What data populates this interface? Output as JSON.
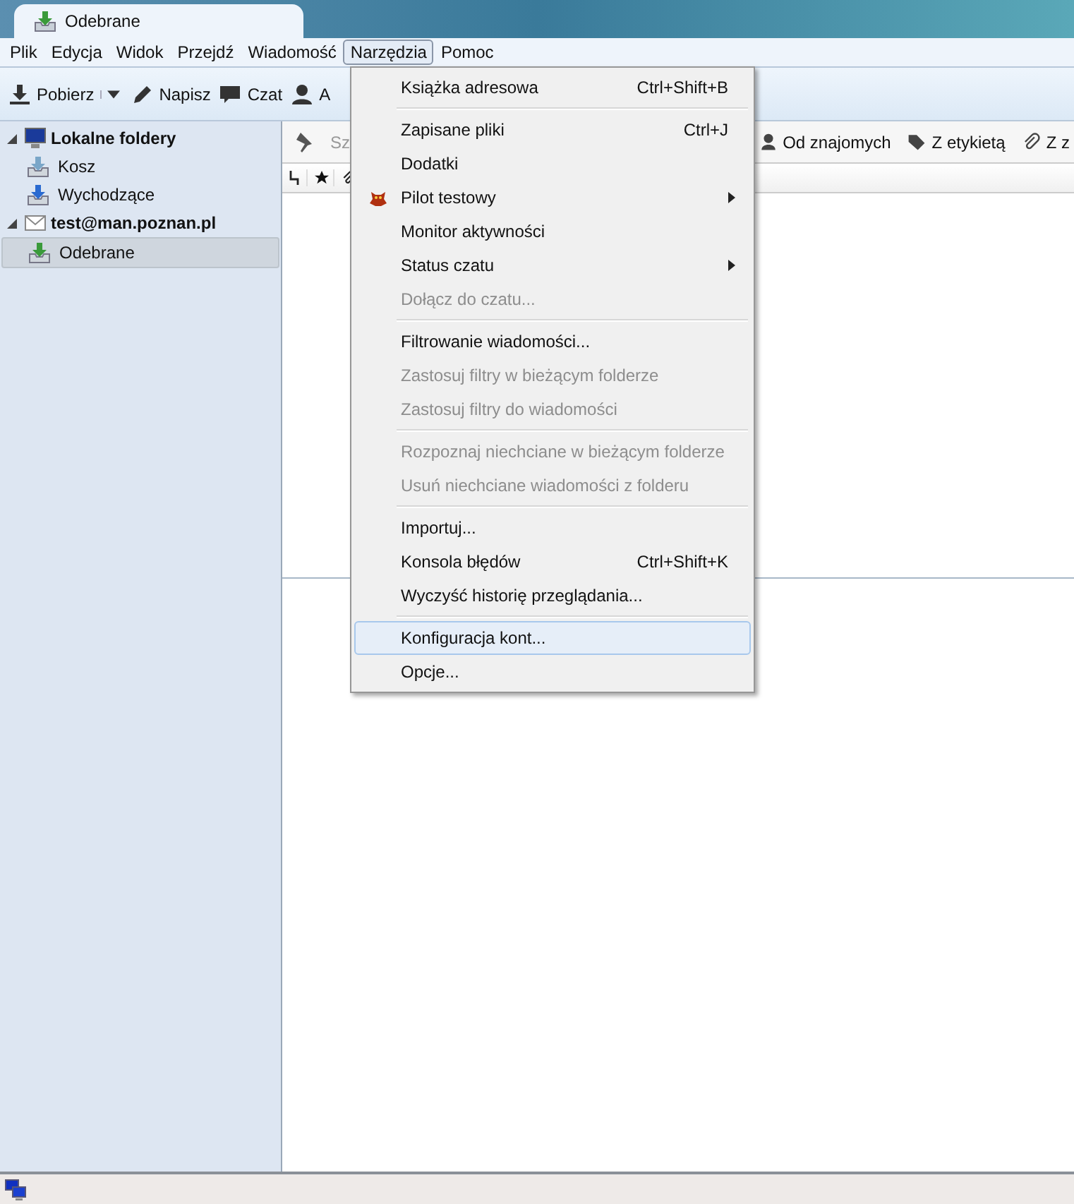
{
  "tab": {
    "title": "Odebrane"
  },
  "menubar": [
    {
      "label": "Plik",
      "selected": false
    },
    {
      "label": "Edycja",
      "selected": false
    },
    {
      "label": "Widok",
      "selected": false
    },
    {
      "label": "Przejdź",
      "selected": false
    },
    {
      "label": "Wiadomość",
      "selected": false
    },
    {
      "label": "Narzędzia",
      "selected": true
    },
    {
      "label": "Pomoc",
      "selected": false
    }
  ],
  "toolbar": [
    {
      "kind": "get",
      "label": "Pobierz"
    },
    {
      "kind": "write",
      "label": "Napisz"
    },
    {
      "kind": "chat",
      "label": "Czat"
    },
    {
      "kind": "contacts",
      "label": "A"
    }
  ],
  "folders": [
    {
      "name": "Lokalne foldery",
      "kind": "local",
      "expanded": true,
      "selected": false,
      "children": [
        {
          "name": "Kosz",
          "kind": "trash",
          "selected": false
        },
        {
          "name": "Wychodzące",
          "kind": "outbox",
          "selected": false
        }
      ]
    },
    {
      "name": "test@man.poznan.pl",
      "kind": "account",
      "expanded": true,
      "selected": false,
      "children": [
        {
          "name": "Odebrane",
          "kind": "inbox",
          "selected": true
        }
      ]
    }
  ],
  "quick_filter": {
    "search_placeholder": "Sz",
    "filters": [
      {
        "kind": "contact",
        "label": "Od znajomych"
      },
      {
        "kind": "tag",
        "label": "Z etykietą"
      },
      {
        "kind": "attach",
        "label": "Z z"
      }
    ]
  },
  "menu": [
    {
      "kind": "item",
      "label": "Książka adresowa",
      "shortcut": "Ctrl+Shift+B",
      "disabled": false,
      "selected": false
    },
    {
      "kind": "separator"
    },
    {
      "kind": "item",
      "label": "Zapisane pliki",
      "shortcut": "Ctrl+J",
      "disabled": false,
      "selected": false
    },
    {
      "kind": "item",
      "label": "Dodatki",
      "disabled": false,
      "selected": false
    },
    {
      "kind": "item",
      "label": "Pilot testowy",
      "disabled": false,
      "selected": false,
      "submenu": true,
      "icon": true
    },
    {
      "kind": "item",
      "label": "Monitor aktywności",
      "disabled": false,
      "selected": false
    },
    {
      "kind": "item",
      "label": "Status czatu",
      "disabled": false,
      "selected": false,
      "submenu": true
    },
    {
      "kind": "item",
      "label": "Dołącz do czatu...",
      "disabled": true,
      "selected": false
    },
    {
      "kind": "separator"
    },
    {
      "kind": "item",
      "label": "Filtrowanie wiadomości...",
      "disabled": false,
      "selected": false
    },
    {
      "kind": "item",
      "label": "Zastosuj filtry w bieżącym folderze",
      "disabled": true,
      "selected": false
    },
    {
      "kind": "item",
      "label": "Zastosuj filtry do wiadomości",
      "disabled": true,
      "selected": false
    },
    {
      "kind": "separator"
    },
    {
      "kind": "item",
      "label": "Rozpoznaj niechciane w bieżącym folderze",
      "disabled": true,
      "selected": false
    },
    {
      "kind": "item",
      "label": "Usuń niechciane wiadomości z folderu",
      "disabled": true,
      "selected": false
    },
    {
      "kind": "separator"
    },
    {
      "kind": "item",
      "label": "Importuj...",
      "disabled": false,
      "selected": false
    },
    {
      "kind": "item",
      "label": "Konsola błędów",
      "shortcut": "Ctrl+Shift+K",
      "disabled": false,
      "selected": false
    },
    {
      "kind": "item",
      "label": "Wyczyść historię przeglądania...",
      "disabled": false,
      "selected": false
    },
    {
      "kind": "separator"
    },
    {
      "kind": "item",
      "label": "Konfiguracja kont...",
      "disabled": false,
      "selected": true
    },
    {
      "kind": "item",
      "label": "Opcje...",
      "disabled": false,
      "selected": false
    }
  ]
}
